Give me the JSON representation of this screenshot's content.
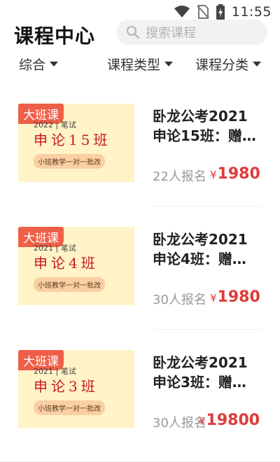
{
  "status_bar": {
    "time": "11:55",
    "icons": [
      "wifi-icon",
      "no-sim-icon",
      "battery-charging-icon"
    ]
  },
  "header": {
    "title": "课程中心",
    "search_placeholder": "搜索课程",
    "search_icon": "search-icon"
  },
  "filters": [
    {
      "label": "综合"
    },
    {
      "label": "课程类型"
    },
    {
      "label": "课程分类"
    }
  ],
  "courses": [
    {
      "tag": "大班课",
      "thumb_year": "2022 | 笔试",
      "thumb_name": "申论15班",
      "thumb_slogan": "小班教学一对一批改",
      "title_line1": "卧龙公考2021",
      "title_line2": "申论15班：赠…",
      "enrollment": "22人报名",
      "currency": "¥",
      "price": "1980"
    },
    {
      "tag": "大班课",
      "thumb_year": "2021 | 笔试",
      "thumb_name": "申论4班",
      "thumb_slogan": "小班教学一对一批改",
      "title_line1": "卧龙公考2021",
      "title_line2": "申论4班：赠…",
      "enrollment": "30人报名",
      "currency": "¥",
      "price": "1980"
    },
    {
      "tag": "大班课",
      "thumb_year": "2021 | 笔试",
      "thumb_name": "申论3班",
      "thumb_slogan": "小班教学一对一批改",
      "title_line1": "卧龙公考2021",
      "title_line2": "申论3班：赠…",
      "enrollment": "30人报名",
      "currency": "¥",
      "price": "19800"
    }
  ],
  "colors": {
    "accent": "#e03a3a",
    "tag": "#ef5f48",
    "thumb_bg": "#fff3c7"
  }
}
